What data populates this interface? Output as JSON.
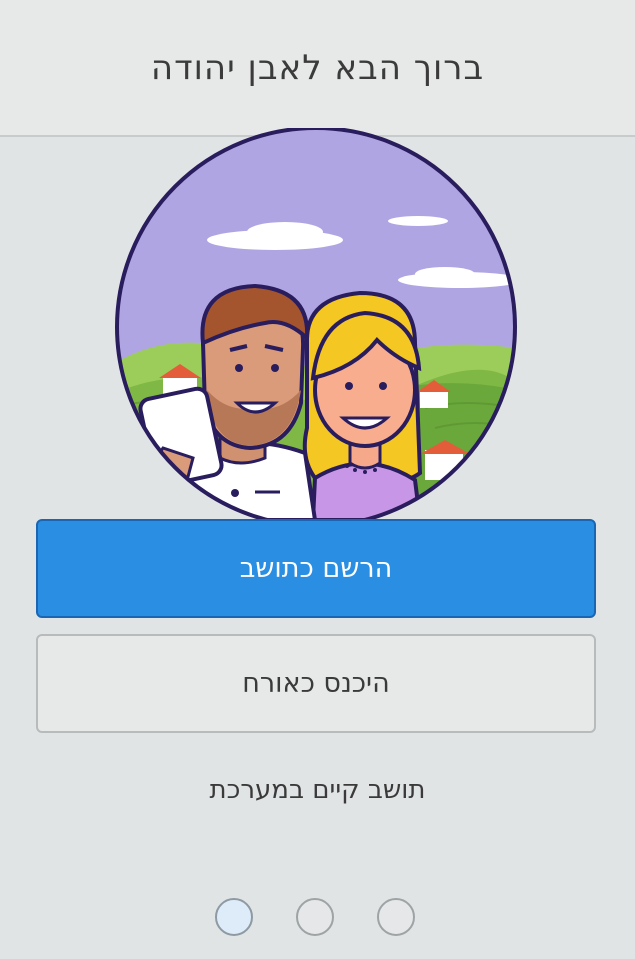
{
  "header": {
    "title": "ברוך הבא לאבן יהודה"
  },
  "hero": {
    "image": "couple-selfie-illustration"
  },
  "buttons": {
    "register_label": "הרשם כתושב",
    "guest_label": "היכנס כאורח"
  },
  "existing_resident_link": "תושב קיים במערכת",
  "pagination": {
    "count": 3,
    "active_index": 0
  },
  "colors": {
    "primary": "#2a8ee2",
    "background": "#e1e4e5",
    "header_bg": "#e7e9e9",
    "sky": "#b0a5e3",
    "outline": "#2a1d5e"
  }
}
